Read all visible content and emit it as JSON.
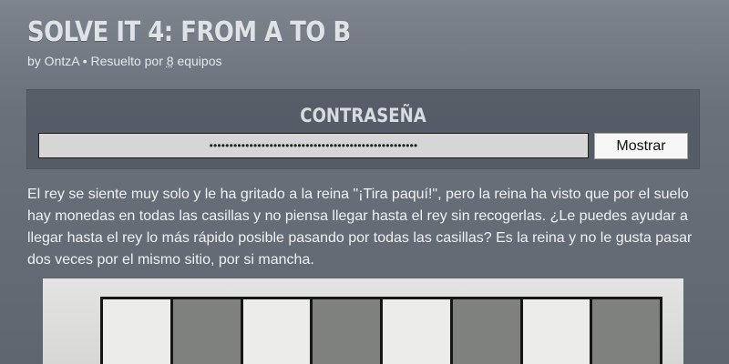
{
  "puzzle": {
    "title": "Solve it 4: from A to B",
    "byline_prefix": "by OntzA • Resuelto por ",
    "teams_count": "8",
    "byline_suffix": " equipos"
  },
  "password": {
    "heading": "Contraseña",
    "masked_value": "••••••••••••••••••••••••••••••••••••••••••••••••••••",
    "show_label": "Mostrar"
  },
  "description": "El rey se siente muy solo y le ha gritado a la reina \"¡Tira paquí!\", pero la reina ha visto que por el suelo hay monedas en todas las casillas y no piensa llegar hasta el rey sin recogerlas. ¿Le puedes ayudar a llegar hasta el rey lo más rápido posible pasando por todas las casillas? Es la reina y no le gusta pasar dos veces por el mismo sitio, por si mancha.",
  "board": {
    "squares": [
      "light",
      "dark",
      "light",
      "dark",
      "light",
      "dark",
      "light",
      "dark"
    ]
  }
}
